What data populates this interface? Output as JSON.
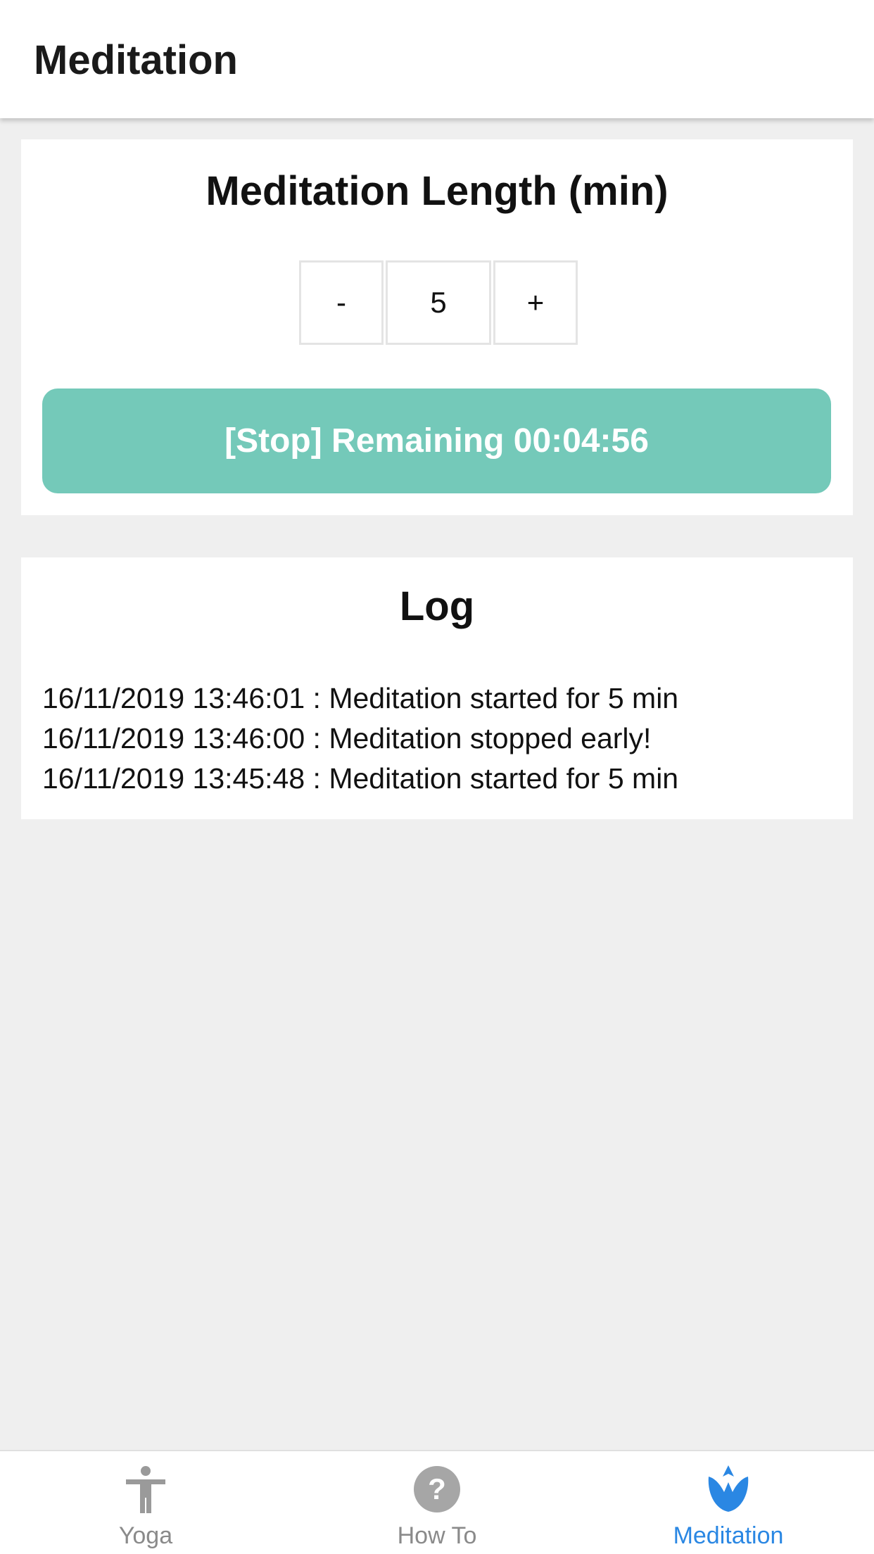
{
  "header": {
    "title": "Meditation"
  },
  "length_card": {
    "heading": "Meditation Length (min)",
    "stepper": {
      "decrement_label": "-",
      "value": "5",
      "increment_label": "+"
    },
    "stop_button_label": "[Stop] Remaining 00:04:56",
    "accent_color": "#74c9b9"
  },
  "log_card": {
    "heading": "Log",
    "entries": [
      "16/11/2019 13:46:01 : Meditation started for 5 min",
      "16/11/2019 13:46:00 : Meditation stopped early!",
      "16/11/2019 13:45:48 : Meditation started for 5 min"
    ]
  },
  "bottom_nav": {
    "items": [
      {
        "label": "Yoga",
        "icon": "person-standing-icon",
        "active": false
      },
      {
        "label": "How To",
        "icon": "help-circle-icon",
        "active": false
      },
      {
        "label": "Meditation",
        "icon": "lotus-icon",
        "active": true
      }
    ],
    "active_color": "#2a87e3",
    "inactive_color": "#8a8a8a"
  }
}
